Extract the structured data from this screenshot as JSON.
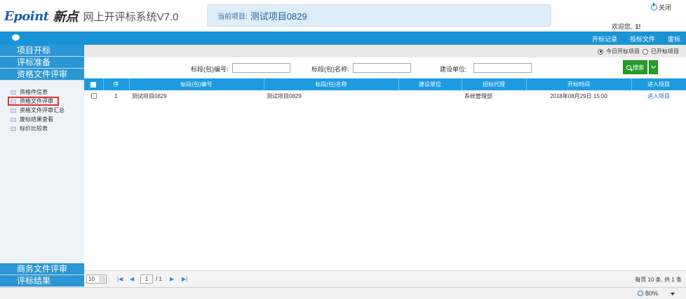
{
  "header": {
    "logo_text": "Epoint",
    "logo_cn": "新点",
    "system_title": "网上开评标系统V7.0",
    "project_label": "当前项目:",
    "project_name": "测试项目0829",
    "close_label": "关闭",
    "welcome_text": "欢迎您,",
    "user_name": "1!"
  },
  "topnav": {
    "links": [
      "开标记录",
      "投标文件",
      "废标"
    ]
  },
  "sidebar": {
    "sections_top": [
      "项目开标",
      "评标准备",
      "资格文件评审"
    ],
    "items": [
      "资格件信息",
      "资格文件评审",
      "资格文件评审汇总",
      "废标结果查看",
      "标价比较表"
    ],
    "selected_index": 1,
    "sections_bottom": [
      "商务文件评审",
      "评标结果"
    ]
  },
  "filters": {
    "radio_today": "今日开标项目",
    "radio_opened": "已开标项目",
    "selected": "today",
    "field1_label": "标段(包)编号:",
    "field2_label": "标段(包)名称:",
    "field3_label": "建设单位:",
    "field1_value": "",
    "field2_value": "",
    "field3_value": "",
    "search_label": "搜索"
  },
  "table": {
    "columns": [
      "序",
      "标段(包)编号",
      "标段(包)名称",
      "建设单位",
      "招标代理",
      "开标时间",
      "进入项目"
    ],
    "rows": [
      {
        "index": "1",
        "code": "测试项目0829",
        "name": "测试项目0829",
        "unit": "",
        "agent": "系统管理部",
        "time": "2018年08月29日 15:00",
        "action": "进入项目"
      }
    ]
  },
  "pager": {
    "page_size": "10",
    "current_page": "1",
    "total_pages": "/ 1",
    "info": "每页 10 条, 共 1 条"
  },
  "statusbar": {
    "zoom": "80%"
  },
  "colors": {
    "primary_blue": "#1a93d6",
    "header_blue": "#1e9be0",
    "search_green": "#22a026",
    "selection_red": "#e0302d"
  }
}
